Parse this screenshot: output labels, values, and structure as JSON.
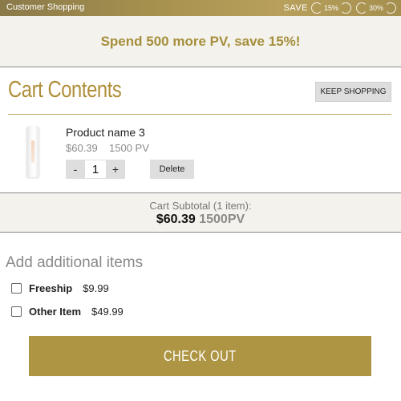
{
  "topbar": {
    "title": "Customer Shopping",
    "save_label": "SAVE",
    "tiers": [
      "15%",
      "30%"
    ]
  },
  "promo": {
    "text": "Spend 500 more PV, save 15%!"
  },
  "cart": {
    "heading": "Cart Contents",
    "keep_shopping_label": "KEEP SHOPPING",
    "items": [
      {
        "name": "Product name 3",
        "price": "$60.39",
        "pv": "1500 PV",
        "quantity": "1",
        "minus_label": "-",
        "plus_label": "+",
        "delete_label": "Delete"
      }
    ]
  },
  "subtotal": {
    "label": "Cart Subtotal (1 item):",
    "amount": "$60.39",
    "pv": "1500PV"
  },
  "additional": {
    "heading": "Add additional items",
    "items": [
      {
        "name": "Freeship",
        "price": "$9.99"
      },
      {
        "name": "Other Item",
        "price": "$49.99"
      }
    ]
  },
  "checkout_label": "CHECK OUT",
  "colors": {
    "accent": "#ae9543",
    "promo_text": "#a58f3c",
    "panel_bg": "#f4f2ec",
    "button_gray": "#dedede"
  }
}
